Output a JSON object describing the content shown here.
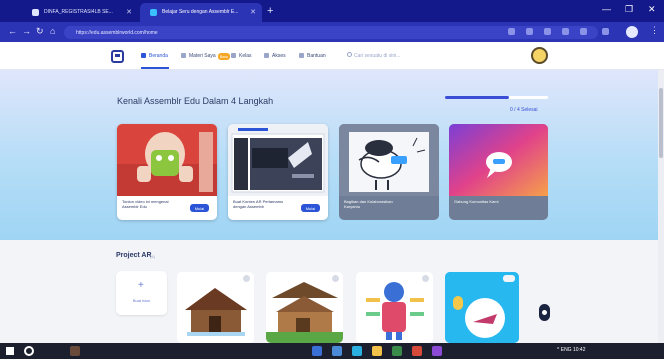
{
  "browser": {
    "tabs": [
      {
        "title": "DINFA_REGISTRASI4LB SE..."
      },
      {
        "title": "Belajar Seru dengan Assemblr E..."
      }
    ],
    "new_tab": "+",
    "url": "https://edu.assemblrworld.com/home",
    "window_controls": {
      "minimize": "—",
      "maximize": "❐",
      "close": "✕"
    },
    "nav": {
      "back": "←",
      "forward": "→",
      "reload": "↻",
      "home": "⌂"
    }
  },
  "site": {
    "nav": [
      {
        "label": "Beranda",
        "active": true
      },
      {
        "label": "Materi Saya",
        "badge": "Baru"
      },
      {
        "label": "Kelas"
      },
      {
        "label": "Akses"
      },
      {
        "label": "Bantuan"
      }
    ],
    "search_placeholder": "Cari sesuatu di sini..."
  },
  "hero": {
    "title": "Kenali Assemblr Edu Dalam 4 Langkah",
    "progress_fraction": 0.62,
    "progress_label": "0 / 4 Selesai",
    "cards": [
      {
        "caption": "Tonton video ini mengenai Assemblr Edu",
        "button": "Mulai"
      },
      {
        "caption": "Buat Konten AR Pertamamu dengan Assemblr",
        "button": "Mulai"
      },
      {
        "caption": "Bagikan dan Kolaborasikan Karyamu"
      },
      {
        "caption": "Gabung Komunitas Kami"
      }
    ]
  },
  "projects": {
    "title": "Project AR",
    "count": "(4)",
    "new_label": "Buat baru"
  },
  "taskbar": {
    "tray": "^ ENG 10:42"
  },
  "colors": {
    "accent": "#2b55d6",
    "browser_bar": "#13198a"
  }
}
